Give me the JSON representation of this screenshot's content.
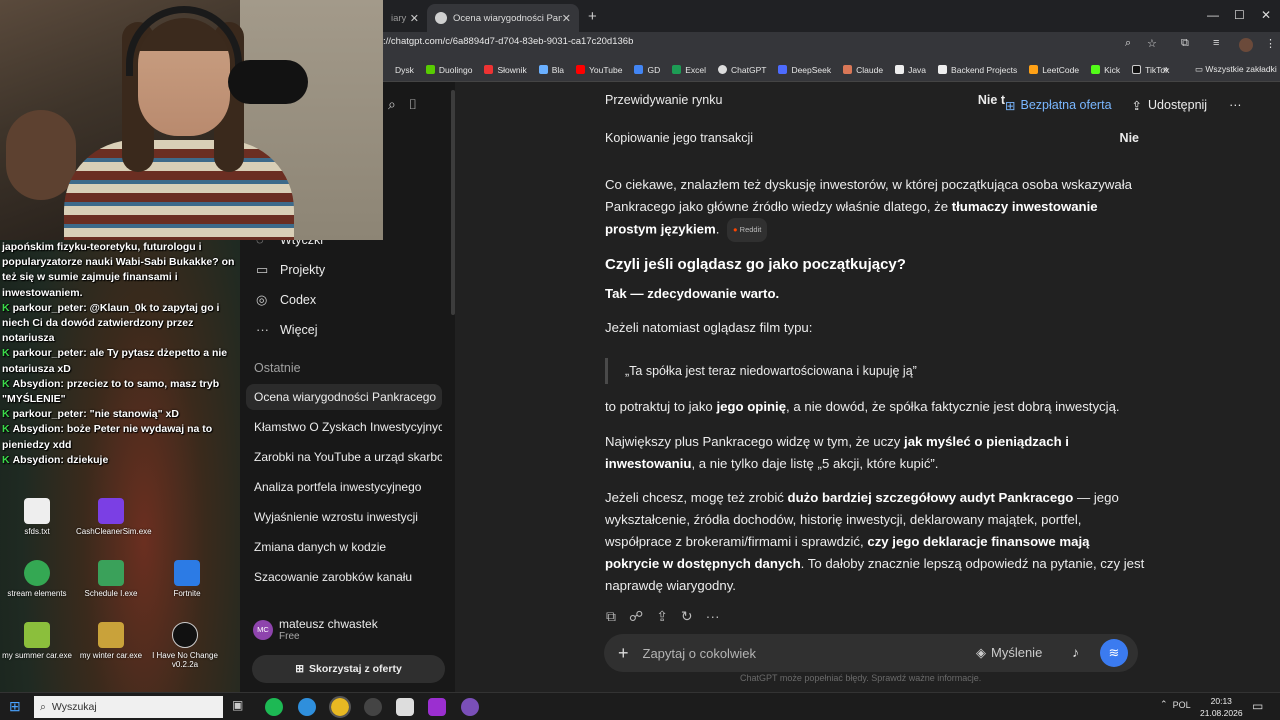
{
  "browser": {
    "tabs": [
      {
        "label": "iary"
      },
      {
        "label": "Ocena wiarygodności Pankrace"
      }
    ],
    "url": "://chatgpt.com/c/6a8894d7-d704-83eb-9031-ca17c20d136b",
    "bookmarks": [
      "Dysk",
      "Duolingo",
      "Słownik",
      "Bla",
      "YouTube",
      "GD",
      "Excel",
      "ChatGPT",
      "DeepSeek",
      "Claude",
      "Java",
      "Backend Projects",
      "LeetCode",
      "Kick",
      "TikTok"
    ],
    "bookmarks_all": "Wszystkie zakładki"
  },
  "stream_chat": [
    {
      "user": "",
      "text": "japońskim fizyku-teoretyku, futurologu i popularyzatorze nauki Wabi-Sabi Bukakke? on też się w sumie zajmuje finansami i inwestowaniem.",
      "badge": false
    },
    {
      "user": "parkour_peter:",
      "text": "@Klaun_0k to zapytaj go i niech Ci da dowód zatwierdzony przez notariusza",
      "badge": true
    },
    {
      "user": "parkour_peter:",
      "text": "ale Ty pytasz dżepetto a nie notariusza xD",
      "badge": true
    },
    {
      "user": "Absydion:",
      "text": "przeciez to to samo, masz tryb \"MYŚLENIE\"",
      "badge": true
    },
    {
      "user": "parkour_peter:",
      "text": "\"nie stanowią\" xD",
      "badge": true
    },
    {
      "user": "Absydion:",
      "text": "boże Peter nie wydawaj na to pieniedzy xdd",
      "badge": true
    },
    {
      "user": "Absydion:",
      "text": "dziekuje",
      "badge": true
    }
  ],
  "desktop_icons": [
    "sfds.txt",
    "CashCleanerSim.exe",
    "stream elements",
    "Schedule I.exe",
    "Fortnite",
    "my summer car.exe",
    "my winter car.exe",
    "I Have No Change v0.2.2a"
  ],
  "sidebar": {
    "nav": [
      {
        "label": "Wtyczki"
      },
      {
        "label": "Projekty"
      },
      {
        "label": "Codex"
      },
      {
        "label": "Więcej"
      }
    ],
    "recent_label": "Ostatnie",
    "items": [
      "Ocena wiarygodności Pankracego",
      "Kłamstwo O Zyskach Inwestycyjnych",
      "Zarobki na YouTube a urząd skarbowy",
      "Analiza portfela inwestycyjnego",
      "Wyjaśnienie wzrostu inwestycji",
      "Zmiana danych w kodzie",
      "Szacowanie zarobków kanału"
    ],
    "user_initials": "MC",
    "user_name": "mateusz chwastek",
    "user_plan": "Free",
    "offer_button": "Skorzystaj z oferty"
  },
  "header": {
    "offer": "Bezpłatna oferta",
    "share": "Udostępnij"
  },
  "table_rows": [
    {
      "label": "Przewidywanie rynku",
      "value": "Nie t"
    },
    {
      "label": "Kopiowanie jego transakcji",
      "value": "Nie"
    }
  ],
  "content": {
    "p1_a": "Co ciekawe, znalazłem też dyskusję inwestorów, w której początkująca osoba wskazywała Pankracego jako główne źródło wiedzy właśnie dlatego, że ",
    "p1_b": "tłumaczy inwestowanie prostym językiem",
    "p1_c": ".",
    "p1_badge": "Reddit",
    "heading": "Czyli jeśli oglądasz go jako początkujący?",
    "p2": "Tak — zdecydowanie warto.",
    "p3": "Jeżeli natomiast oglądasz film typu:",
    "quote": "„Ta spółka jest teraz niedowartościowana i kupuję ją”",
    "p4_a": "to potraktuj to jako ",
    "p4_b": "jego opinię",
    "p4_c": ", a nie dowód, że spółka faktycznie jest dobrą inwestycją.",
    "p5_a": "Największy plus Pankracego widzę w tym, że uczy ",
    "p5_b": "jak myśleć o pieniądzach i inwestowaniu",
    "p5_c": ", a nie tylko daje listę „5 akcji, które kupić”.",
    "p6_a": "Jeżeli chcesz, mogę też zrobić ",
    "p6_b": "dużo bardziej szczegółowy audyt Pankracego",
    "p6_c": " — jego wykształcenie, źródła dochodów, historię inwestycji, deklarowany majątek, portfel, współprace z brokerami/firmami i sprawdzić, ",
    "p6_d": "czy jego deklaracje finansowe mają pokrycie w dostępnych danych",
    "p6_e": ". To dałoby znacznie lepszą odpowiedź na pytanie, czy jest naprawdę wiarygodny."
  },
  "composer": {
    "placeholder": "Zapytaj o cokolwiek",
    "mode": "Myślenie"
  },
  "disclaimer": "ChatGPT może popełniać błędy. Sprawdź ważne informacje.",
  "taskbar": {
    "search_placeholder": "Wyszukaj",
    "lang": "POL",
    "time": "20:13",
    "date": "21.08.2026"
  },
  "colors": {
    "accent": "#3b7bf0",
    "link": "#7ab7ff",
    "chat_badge": "#3bd94a"
  }
}
